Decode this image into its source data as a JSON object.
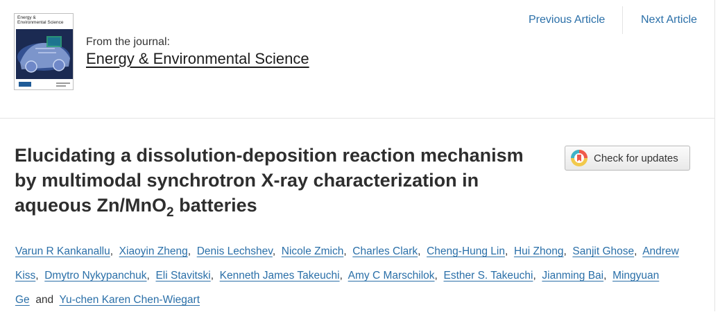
{
  "journal": {
    "cover_title": "Energy & Environmental Science",
    "from_label": "From the journal:",
    "name": "Energy & Environmental Science"
  },
  "nav": {
    "previous": "Previous Article",
    "next": "Next Article"
  },
  "article": {
    "title_main": "Elucidating a dissolution-deposition reaction mechanism by multimodal synchrotron X-ray characterization in aqueous Zn/MnO",
    "title_sub": "2",
    "title_end": " batteries",
    "check_updates_label": "Check for updates",
    "authors": [
      "Varun R Kankanallu",
      "Xiaoyin Zheng",
      "Denis Lechshev",
      "Nicole Zmich",
      "Charles Clark",
      "Cheng-Hung Lin",
      "Hui Zhong",
      "Sanjit Ghose",
      "Andrew Kiss",
      "Dmytro Nykypanchuk",
      "Eli Stavitski",
      "Kenneth James Takeuchi",
      "Amy C Marschilok",
      "Esther S. Takeuchi",
      "Jianming Bai",
      "Mingyuan Ge",
      "Yu-chen Karen Chen-Wiegart"
    ],
    "author_separator": ",",
    "author_last_joiner": "and"
  }
}
